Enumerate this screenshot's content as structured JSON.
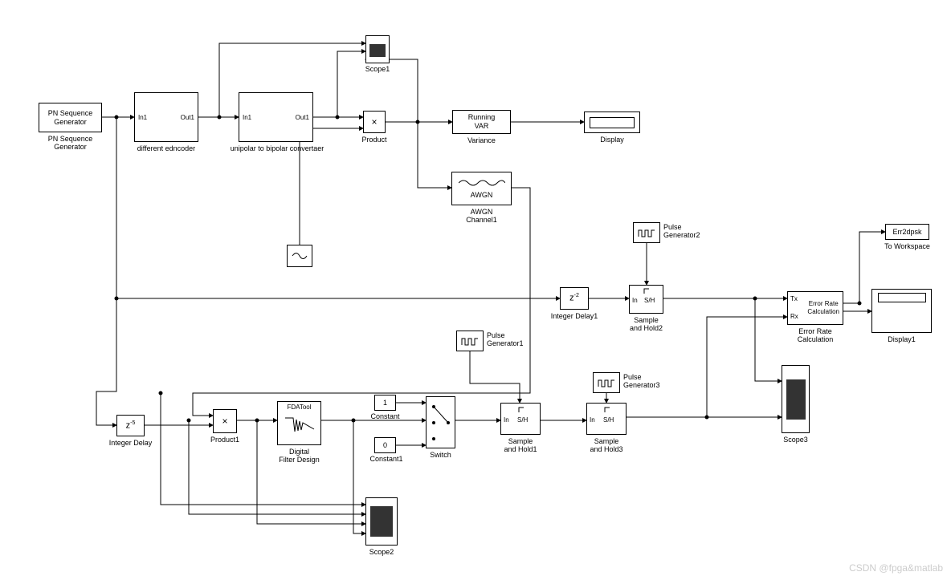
{
  "blocks": {
    "pnseq": {
      "text": "PN Sequence\nGenerator",
      "label": "PN Sequence\nGenerator"
    },
    "diffenc": {
      "in": "In1",
      "out": "Out1",
      "label": "different edncoder"
    },
    "unibip": {
      "in": "In1",
      "out": "Out1",
      "label": "unipolar to bipolar convertaer"
    },
    "product": {
      "sym": "×",
      "label": "Product"
    },
    "scope1": {
      "label": "Scope1"
    },
    "runvar": {
      "text": "Running\nVAR",
      "label": "Variance"
    },
    "display": {
      "label": "Display"
    },
    "awgn": {
      "text": "AWGN",
      "label": "AWGN\nChannel1"
    },
    "intdelay1": {
      "z": "z",
      "exp": "-2",
      "label": "Integer Delay1"
    },
    "intdelay": {
      "z": "z",
      "exp": "-5",
      "label": "Integer Delay"
    },
    "pulse1": {
      "label": "Pulse\nGenerator1"
    },
    "pulse2": {
      "label": "Pulse\nGenerator2"
    },
    "pulse3": {
      "label": "Pulse\nGenerator3"
    },
    "sh1": {
      "in": "In",
      "sh": "S/H",
      "label": "Sample\nand Hold1"
    },
    "sh2": {
      "in": "In",
      "sh": "S/H",
      "label": "Sample\nand Hold2"
    },
    "sh3": {
      "in": "In",
      "sh": "S/H",
      "label": "Sample\nand Hold3"
    },
    "const1": {
      "val": "1",
      "label": "Constant"
    },
    "const2": {
      "val": "0",
      "label": "Constant1"
    },
    "switch": {
      "label": "Switch"
    },
    "product1": {
      "sym": "×",
      "label": "Product1"
    },
    "fdatool": {
      "text": "FDATool",
      "label": "Digital\nFilter Design"
    },
    "scope2": {
      "label": "Scope2"
    },
    "scope3": {
      "label": "Scope3"
    },
    "errcalc": {
      "tx": "Tx",
      "rx": "Rx",
      "text": "Error Rate\nCalculation",
      "label": "Error Rate\nCalculation"
    },
    "tows": {
      "text": "Err2dpsk",
      "label": "To Workspace"
    },
    "display1": {
      "label": "Display1"
    },
    "sine": {
      "label": ""
    }
  },
  "watermark": "CSDN @fpga&matlab"
}
